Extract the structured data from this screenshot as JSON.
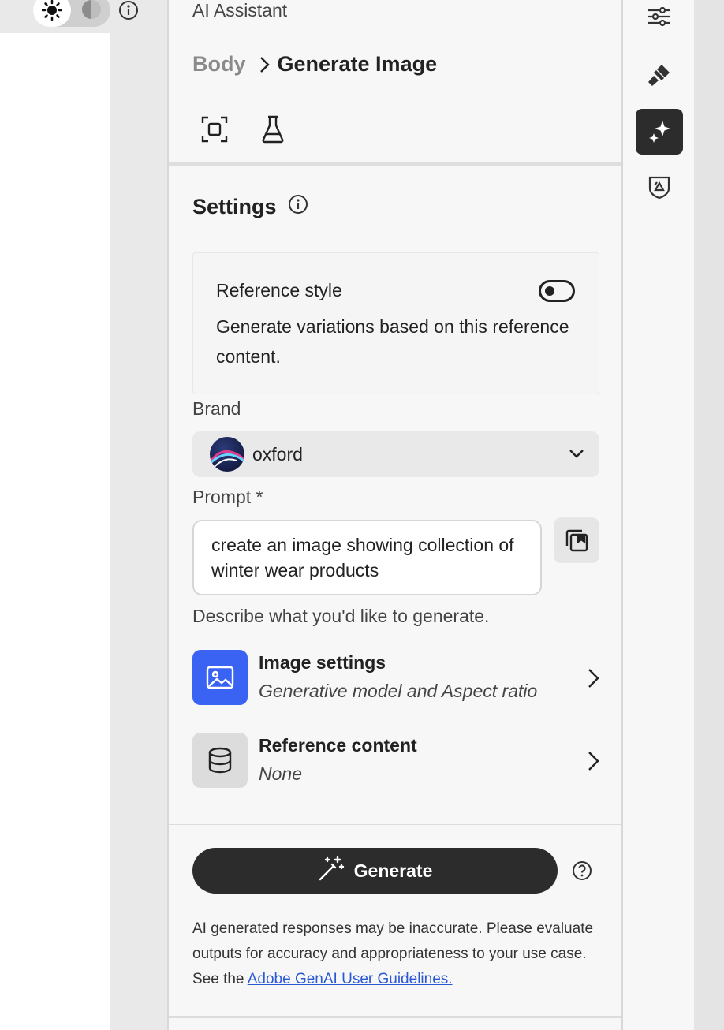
{
  "app": {
    "title": "AI Assistant"
  },
  "breadcrumb": {
    "parent": "Body",
    "current": "Generate Image"
  },
  "toolbar": {
    "tools": [
      "frame-select-icon",
      "flask-icon"
    ]
  },
  "settings": {
    "title": "Settings"
  },
  "reference_style": {
    "label": "Reference style",
    "description": "Generate variations based on this reference content.",
    "enabled": false
  },
  "brand": {
    "label": "Brand",
    "value": "oxford"
  },
  "prompt": {
    "label": "Prompt *",
    "value": "create an image showing collection of winter wear products",
    "hint": "Describe what you'd like to generate."
  },
  "options": {
    "image_settings": {
      "title": "Image settings",
      "subtitle": "Generative model and Aspect ratio",
      "accent": "#3b63f3"
    },
    "reference_content": {
      "title": "Reference content",
      "subtitle": "None"
    }
  },
  "generate": {
    "label": "Generate"
  },
  "disclaimer": {
    "text": "AI generated responses may be inaccurate. Please evaluate outputs for accuracy and appropriateness to your use case. See the ",
    "link": "Adobe GenAI User Guidelines."
  },
  "rail": {
    "items": [
      "sliders-icon",
      "brush-icon",
      "sparkle-icon",
      "badge-icon"
    ],
    "active": "sparkle-icon"
  }
}
